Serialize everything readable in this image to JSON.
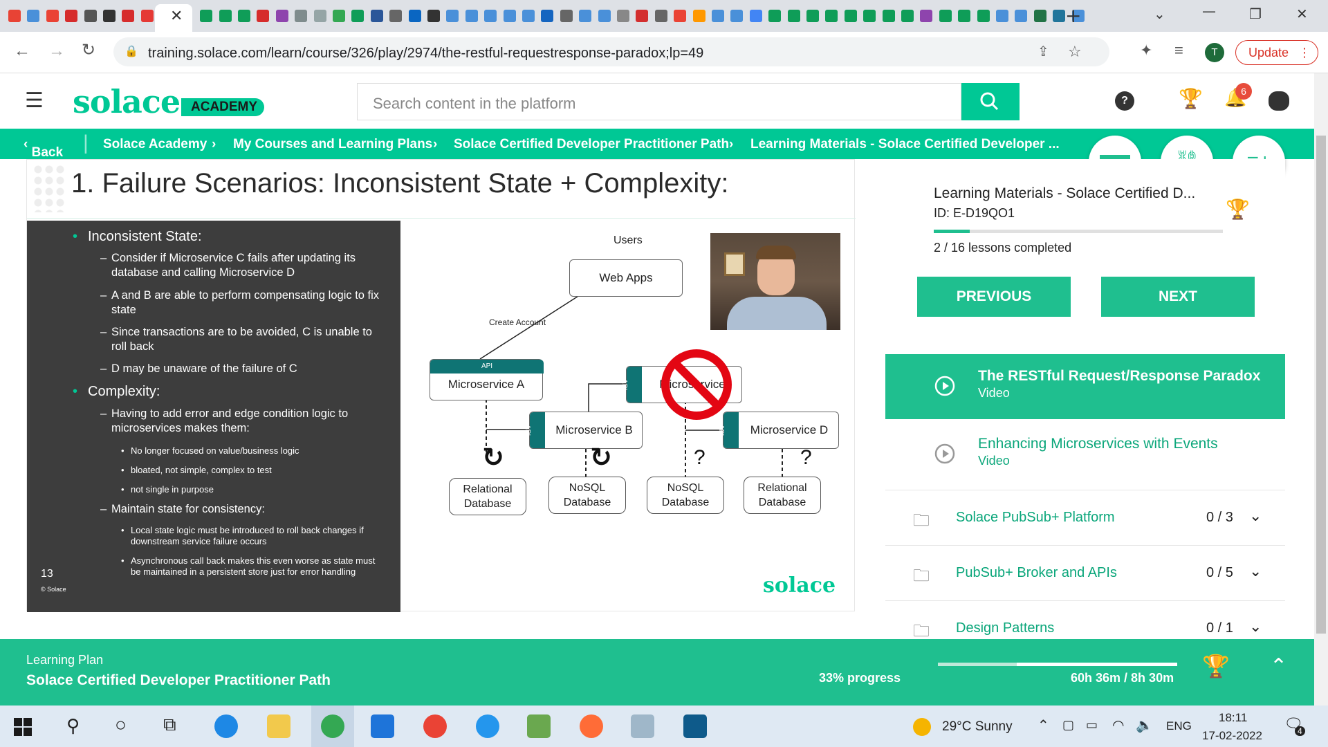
{
  "browser": {
    "url": "training.solace.com/learn/course/326/play/2974/the-restful-requestresponse-paradox;lp=49",
    "update_label": "Update",
    "profile_initial": "T",
    "tab_colors": [
      "#e84335",
      "#4a90d9",
      "#ea4335",
      "#d62c2c",
      "#555555",
      "#333333",
      "#d62c2c",
      "#e53935",
      "#0f9d58",
      "#0f9d58",
      "#0f9d58",
      "#d62c2c",
      "#8e44ad",
      "#7f8c8d",
      "#95a5a6",
      "#34a853",
      "#0f9d58",
      "#2a5699",
      "#666666",
      "#0a66c2",
      "#333333",
      "#4a90d9",
      "#4a90d9",
      "#4a90d9",
      "#4a90d9",
      "#4a90d9",
      "#1565c0",
      "#666666",
      "#4a90d9",
      "#4a90d9",
      "#888888",
      "#d32f2f",
      "#666666",
      "#ea4335",
      "#ff9800",
      "#4a90d9",
      "#4a90d9",
      "#4285f4",
      "#0f9d58",
      "#0f9d58",
      "#0f9d58",
      "#0f9d58",
      "#0f9d58",
      "#0f9d58",
      "#0f9d58",
      "#0f9d58",
      "#8e44ad",
      "#0f9d58",
      "#0f9d58",
      "#0f9d58",
      "#4a90d9",
      "#4a90d9",
      "#217346",
      "#21759b",
      "#4a90d9"
    ]
  },
  "header": {
    "logo": "solace",
    "academy": "ACADEMY",
    "search_placeholder": "Search content in the platform",
    "notification_count": "6"
  },
  "breadcrumb": {
    "back": "Back",
    "items": [
      "Solace Academy",
      "My Courses and Learning Plans",
      "Solace Certified Developer Practitioner Path",
      "Learning Materials - Solace Certified Developer ..."
    ]
  },
  "slide": {
    "title": "1. Failure Scenarios: Inconsistent State + Complexity:",
    "page_number": "13",
    "copyright": "© Solace",
    "brand": "solace",
    "bullets": {
      "b1": "Inconsistent State:",
      "b1_1": "Consider if Microservice C fails after updating its database and calling Microservice D",
      "b1_2": "A and B are able to perform compensating logic to fix state",
      "b1_3": "Since transactions are to be avoided, C is unable to roll back",
      "b1_4": "D may be unaware of the failure of C",
      "b2": "Complexity:",
      "b2_1": "Having to add error and edge condition logic to microservices makes them:",
      "b2_1_1": "No longer focused on value/business logic",
      "b2_1_2": "bloated, not simple, complex to test",
      "b2_1_3": "not single in purpose",
      "b2_2": "Maintain state for consistency:",
      "b2_2_1": "Local state logic must be introduced to roll back changes if downstream service failure occurs",
      "b2_2_2": "Asynchronous call back makes this even worse as state must be maintained in a persistent store just for error handling"
    },
    "diagram": {
      "users": "Users",
      "web_apps": "Web Apps",
      "create_account": "Create Account",
      "api": "API",
      "ms_a": "Microservice A",
      "ms_b": "Microservice B",
      "ms_c": "Microservice",
      "ms_d": "Microservice D",
      "db1": "Relational Database",
      "db2": "NoSQL Database",
      "db3": "NoSQL Database",
      "db4": "Relational Database",
      "q": "?"
    }
  },
  "panel": {
    "course_title": "Learning Materials - Solace Certified D...",
    "course_id": "ID: E-D19QO1",
    "lessons_completed": "2 / 16 lessons completed",
    "lessons_progress": 0.125,
    "previous": "PREVIOUS",
    "next": "NEXT",
    "lessons": [
      {
        "title": "The RESTful Request/Response Paradox",
        "type": "Video",
        "active": true
      },
      {
        "title": "Enhancing Microservices with Events",
        "type": "Video",
        "active": false
      }
    ],
    "modules": [
      {
        "title": "Solace PubSub+ Platform",
        "count": "0 / 3"
      },
      {
        "title": "PubSub+ Broker and APIs",
        "count": "0 / 5"
      },
      {
        "title": "Design Patterns",
        "count": "0 / 1"
      }
    ]
  },
  "footer": {
    "label": "Learning Plan",
    "plan": "Solace Certified Developer Practitioner Path",
    "progress_text": "33% progress",
    "progress": 0.33,
    "time": "60h 36m / 8h 30m"
  },
  "taskbar": {
    "weather": "29°C  Sunny",
    "lang": "ENG",
    "time": "18:11",
    "date": "17-02-2022",
    "notif": "4"
  },
  "colors": {
    "accent": "#1fbf8f",
    "dark": "#3d3d3d",
    "api_teal": "#0f7474"
  }
}
